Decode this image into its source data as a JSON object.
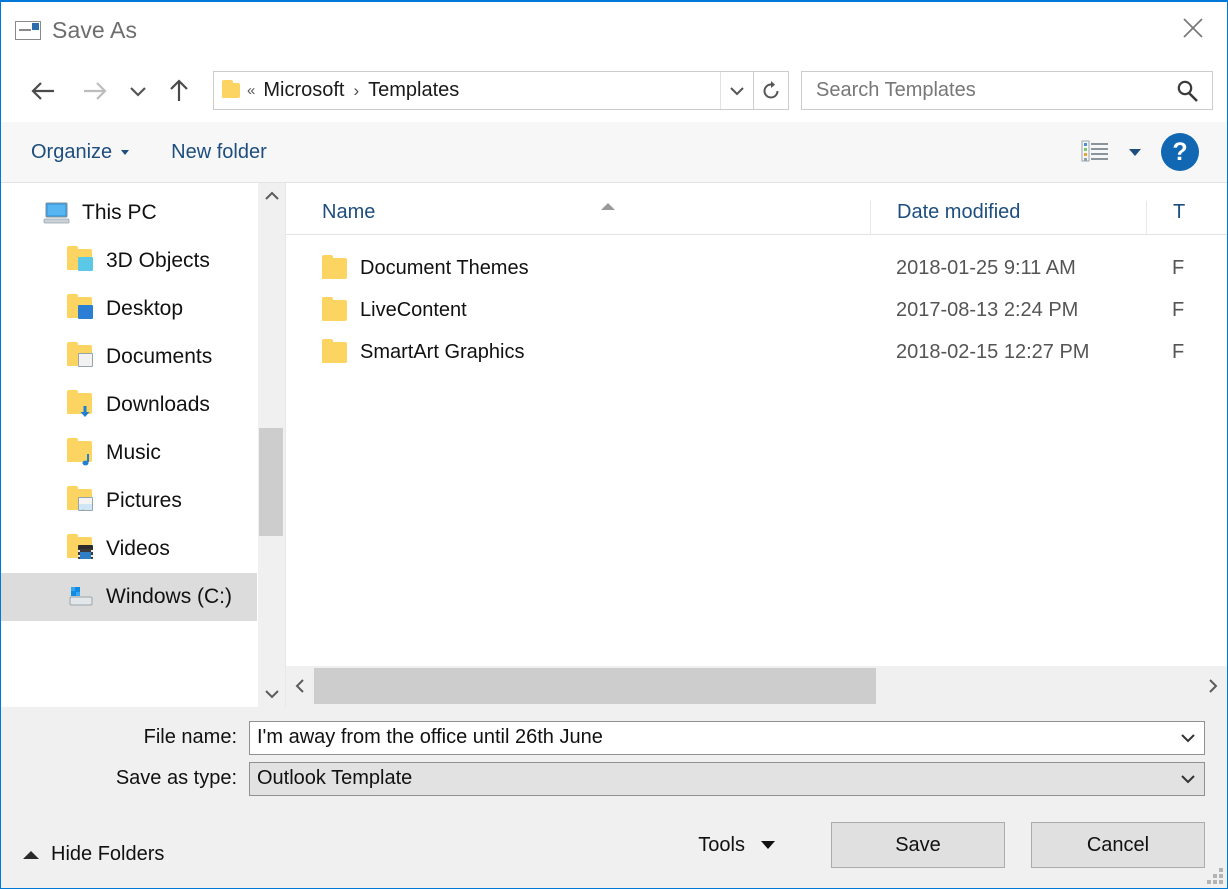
{
  "window": {
    "title": "Save As",
    "title_icon": "template-file-icon",
    "close_label": "✕"
  },
  "nav": {
    "back_icon": "arrow-left-icon",
    "forward_icon": "arrow-right-icon",
    "recent_icon": "chevron-down-icon",
    "up_icon": "arrow-up-icon",
    "refresh_icon": "refresh-icon",
    "address": {
      "folder_icon": "folder-icon",
      "overflow": "«",
      "separator": "›",
      "crumbs": [
        "Microsoft",
        "Templates"
      ],
      "dropdown_icon": "chevron-down-icon"
    },
    "search": {
      "placeholder": "Search Templates",
      "value": "",
      "icon": "search-icon"
    }
  },
  "commandbar": {
    "organize_label": "Organize",
    "new_folder_label": "New folder",
    "view_icon": "view-details-icon",
    "view_caret_icon": "chevron-down-icon",
    "help_label": "?",
    "help_icon": "help-icon"
  },
  "sidebar": {
    "items": [
      {
        "label": "This PC",
        "icon": "this-pc-icon",
        "level": "root",
        "selected": false
      },
      {
        "label": "3D Objects",
        "icon": "3d-objects-icon",
        "level": "child",
        "selected": false
      },
      {
        "label": "Desktop",
        "icon": "desktop-icon",
        "level": "child",
        "selected": false
      },
      {
        "label": "Documents",
        "icon": "documents-icon",
        "level": "child",
        "selected": false
      },
      {
        "label": "Downloads",
        "icon": "downloads-icon",
        "level": "child",
        "selected": false
      },
      {
        "label": "Music",
        "icon": "music-icon",
        "level": "child",
        "selected": false
      },
      {
        "label": "Pictures",
        "icon": "pictures-icon",
        "level": "child",
        "selected": false
      },
      {
        "label": "Videos",
        "icon": "videos-icon",
        "level": "child",
        "selected": false
      },
      {
        "label": "Windows (C:)",
        "icon": "drive-icon",
        "level": "child",
        "selected": true
      }
    ],
    "scroll_up_icon": "chevron-up-icon",
    "scroll_down_icon": "chevron-down-icon"
  },
  "filelist": {
    "columns": [
      "Name",
      "Date modified",
      "T"
    ],
    "sort_column": "Name",
    "sort_direction": "ascending",
    "rows": [
      {
        "name": "Document Themes",
        "date": "2018-01-25 9:11 AM",
        "type": "F",
        "icon": "folder-icon"
      },
      {
        "name": "LiveContent",
        "date": "2017-08-13 2:24 PM",
        "type": "F",
        "icon": "folder-icon"
      },
      {
        "name": "SmartArt Graphics",
        "date": "2018-02-15 12:27 PM",
        "type": "F",
        "icon": "folder-icon"
      }
    ],
    "hscroll_left_icon": "chevron-left-icon",
    "hscroll_right_icon": "chevron-right-icon"
  },
  "form": {
    "filename_label": "File name:",
    "filename_value": "I'm away from the office until 26th June",
    "filetype_label": "Save as type:",
    "filetype_value": "Outlook Template",
    "dropdown_icon": "chevron-down-icon"
  },
  "footer": {
    "hide_folders_label": "Hide Folders",
    "hide_folders_icon": "chevron-up-icon",
    "tools_label": "Tools",
    "tools_caret_icon": "chevron-down-icon",
    "save_label": "Save",
    "cancel_label": "Cancel",
    "resize_grip_icon": "resize-grip-icon"
  },
  "colors": {
    "accent": "#0078d7",
    "link": "#1d4e7e",
    "folder": "#fcd462",
    "selection": "#dcdcdc",
    "chrome": "#f0f0f0"
  }
}
